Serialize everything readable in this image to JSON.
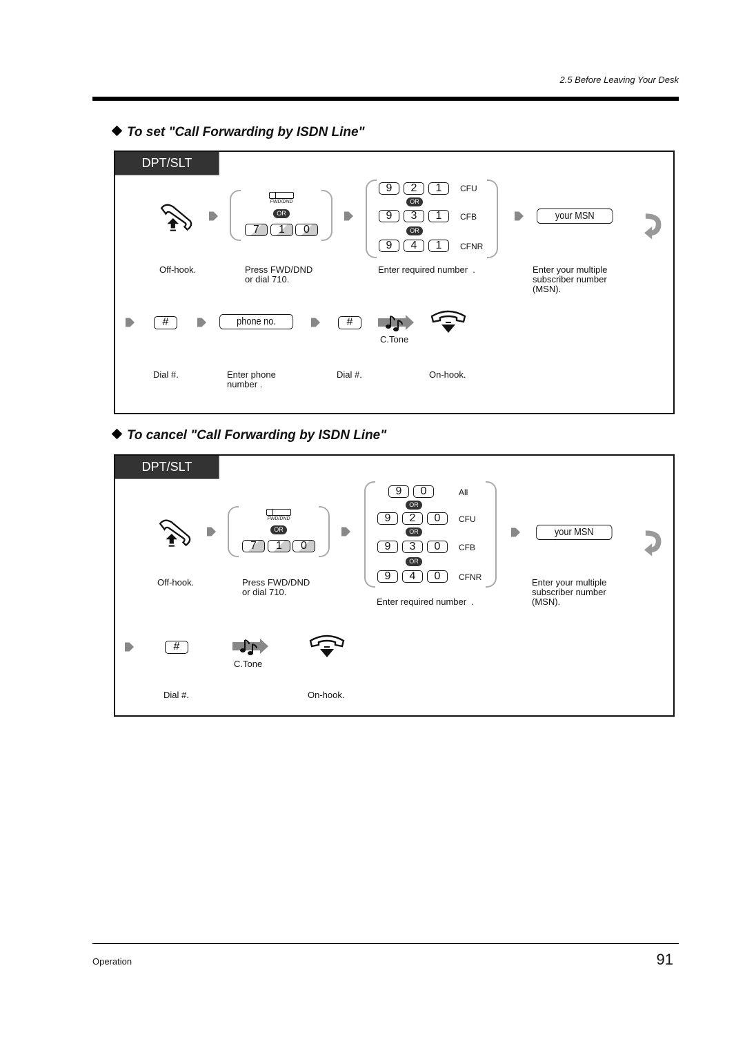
{
  "header": {
    "section": "2.5   Before Leaving Your Desk"
  },
  "set_section": {
    "title": "To set \"Call Forwarding by ISDN Line\"",
    "tag": "DPT/SLT",
    "fwd_button_label": "FWD/DND",
    "or": "OR",
    "dial_keys": [
      "7",
      "1",
      "0"
    ],
    "options": [
      {
        "keys": [
          "9",
          "2",
          "1"
        ],
        "code": "CFU"
      },
      {
        "keys": [
          "9",
          "3",
          "1"
        ],
        "code": "CFB"
      },
      {
        "keys": [
          "9",
          "4",
          "1"
        ],
        "code": "CFNR"
      }
    ],
    "msn_field": "your MSN",
    "phone_field": "phone no.",
    "hash_key": "#",
    "tone_label": "C.Tone",
    "captions": {
      "offhook": "Off-hook.",
      "press_fwd": "Press FWD/DND\nor dial 710.",
      "enter_required": "Enter required number  .",
      "enter_msn": "Enter your multiple\nsubscriber number\n(MSN).",
      "dial_hash_1": "Dial #.",
      "enter_phone": "Enter phone\nnumber .",
      "dial_hash_2": "Dial #.",
      "onhook": "On-hook."
    }
  },
  "cancel_section": {
    "title": "To cancel \"Call Forwarding by ISDN Line\"",
    "tag": "DPT/SLT",
    "fwd_button_label": "FWD/DND",
    "or": "OR",
    "dial_keys": [
      "7",
      "1",
      "0"
    ],
    "options": [
      {
        "keys": [
          "9",
          "0"
        ],
        "code": "All"
      },
      {
        "keys": [
          "9",
          "2",
          "0"
        ],
        "code": "CFU"
      },
      {
        "keys": [
          "9",
          "3",
          "0"
        ],
        "code": "CFB"
      },
      {
        "keys": [
          "9",
          "4",
          "0"
        ],
        "code": "CFNR"
      }
    ],
    "msn_field": "your MSN",
    "hash_key": "#",
    "tone_label": "C.Tone",
    "captions": {
      "offhook": "Off-hook.",
      "press_fwd": "Press FWD/DND\nor dial 710.",
      "enter_required": "Enter required number  .",
      "enter_msn": "Enter your multiple\nsubscriber number\n(MSN).",
      "dial_hash": "Dial #.",
      "onhook": "On-hook."
    }
  },
  "footer": {
    "left": "Operation",
    "page_number": "91"
  }
}
